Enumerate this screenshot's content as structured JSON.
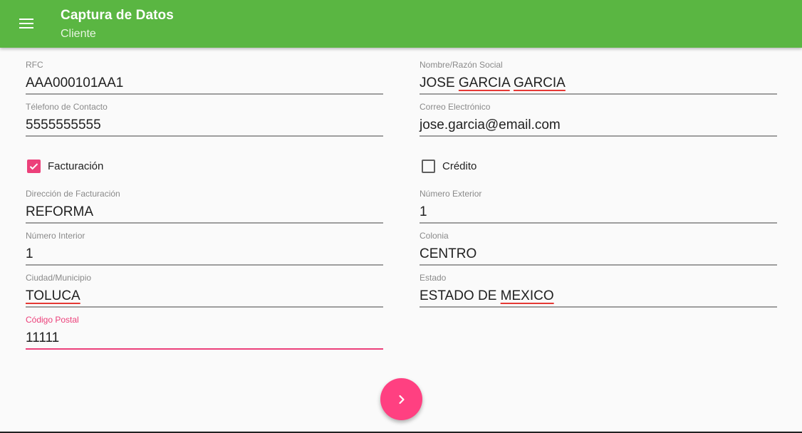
{
  "appbar": {
    "title": "Captura de Datos",
    "subtitle": "Cliente"
  },
  "fields": {
    "rfc": {
      "label": "RFC",
      "value": "AAA000101AA1"
    },
    "nombre": {
      "label": "Nombre/Razón Social",
      "value_parts": [
        "JOSE ",
        "GARCIA",
        " ",
        "GARCIA"
      ]
    },
    "telefono": {
      "label": "Télefono de Contacto",
      "value": "5555555555"
    },
    "correo": {
      "label": "Correo Electrónico",
      "value": "jose.garcia@email.com"
    },
    "direccion": {
      "label": "Dirección de Facturación",
      "value": "REFORMA"
    },
    "num_exterior": {
      "label": "Número Exterior",
      "value": "1"
    },
    "num_interior": {
      "label": "Número Interior",
      "value": "1"
    },
    "colonia": {
      "label": "Colonia",
      "value": "CENTRO"
    },
    "ciudad": {
      "label": "Ciudad/Municipio",
      "value": "TOLUCA"
    },
    "estado": {
      "label": "Estado",
      "value_parts": [
        "ESTADO DE ",
        "MEXICO"
      ]
    },
    "codigo_postal": {
      "label": "Código Postal",
      "value": "11111"
    }
  },
  "checkboxes": {
    "facturacion": {
      "label": "Facturación",
      "checked": true
    },
    "credito": {
      "label": "Crédito",
      "checked": false
    }
  },
  "fab": {
    "icon": "chevron-right-icon"
  },
  "colors": {
    "appbar": "#5ab642",
    "accent": "#ec407a",
    "fab": "#ff4081"
  }
}
